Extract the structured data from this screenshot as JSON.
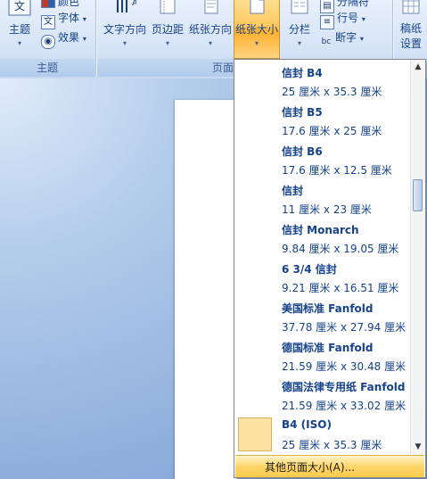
{
  "ribbon": {
    "themes_group": {
      "themes_label": "主题",
      "colors_label": "颜色",
      "fonts_label": "字体",
      "effects_label": "效果",
      "group_label": "主题"
    },
    "page_setup_group": {
      "text_direction_label": "文字方向",
      "margins_label": "页边距",
      "orientation_label": "纸张方向",
      "size_label": "纸张大小",
      "columns_label": "分栏",
      "breaks_label": "分隔符",
      "line_numbers_label": "行号",
      "hyphenation_label": "断字",
      "group_label": "页面"
    },
    "manuscript_group": {
      "manuscript_label": "稿纸\n设置"
    },
    "dropdown_arrow": "▾"
  },
  "paper_sizes": {
    "items": [
      {
        "name": "信封 B4",
        "dims": "25 厘米 x 35.3 厘米"
      },
      {
        "name": "信封 B5",
        "dims": "17.6 厘米 x 25 厘米"
      },
      {
        "name": "信封 B6",
        "dims": "17.6 厘米 x 12.5 厘米"
      },
      {
        "name": "信封",
        "dims": "11 厘米 x 23 厘米"
      },
      {
        "name": "信封 Monarch",
        "dims": "9.84 厘米 x 19.05 厘米"
      },
      {
        "name": "6 3/4 信封",
        "dims": "9.21 厘米 x 16.51 厘米"
      },
      {
        "name": "美国标准 Fanfold",
        "dims": "37.78 厘米 x 27.94 厘米"
      },
      {
        "name": "德国标准 Fanfold",
        "dims": "21.59 厘米 x 30.48 厘米"
      },
      {
        "name": "德国法律专用纸 Fanfold",
        "dims": "21.59 厘米 x 33.02 厘米"
      },
      {
        "name": "B4 (ISO)",
        "dims": "25 厘米 x 35.3 厘米"
      }
    ],
    "more_label": "其他页面大小(A)...",
    "scroll_up": "▲",
    "scroll_down": "▼"
  },
  "colors": {
    "accent_active": "#ffc760",
    "text": "#15428b",
    "thumb": "#fde1a2"
  }
}
